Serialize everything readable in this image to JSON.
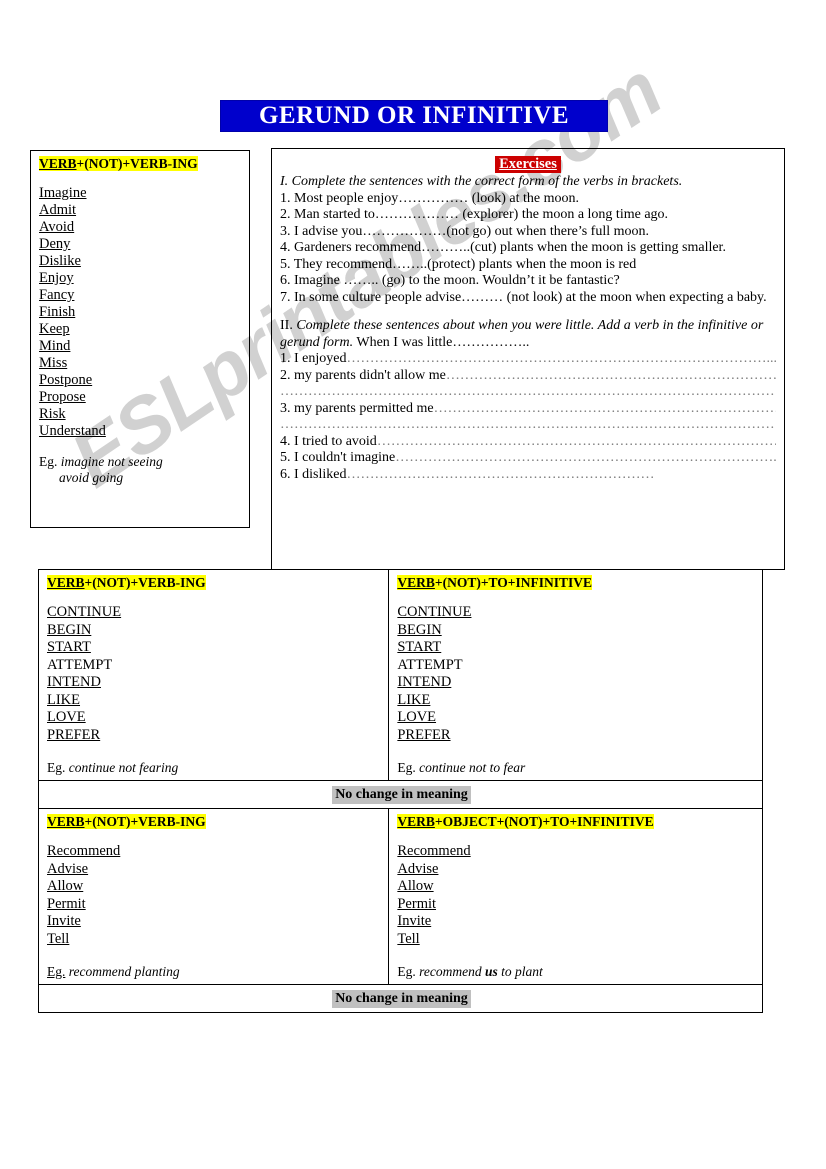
{
  "title": "GERUND OR INFINITIVE",
  "watermark": "ESLprintables.com",
  "colors": {
    "title_bg": "#0000cc",
    "title_fg": "#ffffff",
    "highlight": "#ffff00",
    "exercises_bg": "#cc0000",
    "nochange_bg": "#c0c0c0",
    "watermark": "#c9c9c9"
  },
  "left_panel": {
    "heading_underlined": "VERB",
    "heading_rest": "+(NOT)+VERB-ING",
    "verbs": [
      "Imagine",
      "Admit",
      "Avoid",
      "Deny",
      "Dislike",
      "Enjoy",
      "Fancy",
      "Finish",
      "Keep",
      "Mind",
      "Miss",
      "Postpone",
      "Propose",
      "Risk",
      "Understand"
    ],
    "eg_label": "Eg.",
    "eg_line1": "imagine not seeing",
    "eg_line2": "avoid going"
  },
  "exercises": {
    "heading": "Exercises",
    "part1_instruction": "I. Complete the sentences with the correct form of the verbs in brackets.",
    "part1_items": [
      "1. Most people enjoy…………… (look) at the moon.",
      "2. Man started to……………… (explorer) the moon a long time ago.",
      "3. I advise you………………(not go) out when there’s full moon.",
      "4. Gardeners recommend………..(cut) plants when the moon is getting smaller.",
      "5. They recommend……..(protect) plants when the moon is red",
      "6. Imagine …….. (go) to the moon. Wouldn’t it be fantastic?",
      "7. In some culture people advise……… (not look) at the moon when expecting a baby."
    ],
    "part2_number": "II.",
    "part2_instruction_italic": "Complete these sentences about when you were little. Add a verb in the infinitive or gerund form.",
    "part2_instruction_rest": "When I was little……………..",
    "part2_items": [
      "1. I enjoyed……………………………………………………………………………….....",
      "2. my parents didn't allow me………………………………………………………………",
      "……………………………………………………………………………………………….",
      "3. my parents permitted me………………………………………………………………….",
      "……………………………………………………………………………………………….",
      "4. I tried to avoid……………………………………………………………………………",
      "5. I couldn't imagine………………………………………………………………………..",
      "6. I disliked…………………………………………………………"
    ]
  },
  "table": {
    "row1": {
      "left": {
        "heading_underlined": "VERB",
        "heading_rest": "+(NOT)+VERB-ING",
        "verbs": [
          "CONTINUE",
          "BEGIN",
          "START",
          "ATTEMPT",
          "INTEND",
          "LIKE",
          "LOVE",
          "PREFER"
        ],
        "unlinked_verbs": [
          "ATTEMPT"
        ],
        "eg_label": "Eg.",
        "eg_text": "continue not fearing"
      },
      "right": {
        "heading_underlined": "VERB",
        "heading_rest": "+(NOT)+TO+INFINITIVE",
        "verbs": [
          "CONTINUE",
          "BEGIN",
          "START",
          "ATTEMPT",
          "INTEND",
          "LIKE",
          "LOVE",
          "PREFER"
        ],
        "unlinked_verbs": [
          "ATTEMPT"
        ],
        "eg_label": "Eg.",
        "eg_text": "continue not to fear"
      },
      "footer": "No change in meaning"
    },
    "row2": {
      "left": {
        "heading_underlined": "VERB",
        "heading_rest": "+(NOT)+VERB-ING",
        "verbs": [
          "Recommend",
          "Advise",
          "Allow",
          "Permit",
          "Invite",
          "Tell"
        ],
        "eg_label": "Eg.",
        "eg_text": "recommend planting"
      },
      "right": {
        "heading_underlined": "VERB",
        "heading_rest": "+OBJECT+(NOT)+TO+INFINITIVE",
        "verbs": [
          "Recommend",
          "Advise",
          "Allow",
          "Permit",
          "Invite",
          "Tell"
        ],
        "eg_label": "Eg.",
        "eg_text_pre": "recommend ",
        "eg_text_bold": "us",
        "eg_text_post": " to plant"
      },
      "footer": "No change in meaning"
    }
  }
}
